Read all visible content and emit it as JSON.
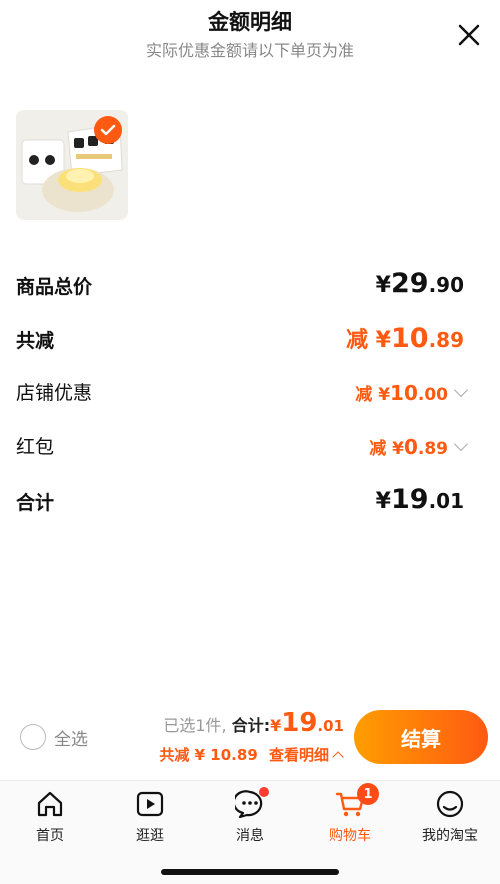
{
  "header": {
    "title": "金额明细",
    "subtitle": "实际优惠金额请以下单页为准"
  },
  "rows": [
    {
      "label": "商品总价",
      "prefix": "¥",
      "int": "29",
      "dec": ".90"
    },
    {
      "label": "共减",
      "prefix": "减 ¥",
      "int": "10",
      "dec": ".89"
    },
    {
      "label": "店铺优惠",
      "prefix": "减 ¥",
      "int": "10",
      "dec": ".00"
    },
    {
      "label": "红包",
      "prefix": "减 ¥",
      "int": "0",
      "dec": ".89"
    },
    {
      "label": "合计",
      "prefix": "¥",
      "int": "19",
      "dec": ".01"
    }
  ],
  "bottom": {
    "select_all": "全选",
    "selected_count": "已选1件,",
    "total_label": "合计:",
    "total_prefix": "¥",
    "total_int": "19",
    "total_dec": ".01",
    "discount_text": "共减 ¥ 10.89",
    "view_detail": "查看明细",
    "checkout": "结算"
  },
  "tabs": [
    {
      "label": "首页",
      "icon": "home-icon"
    },
    {
      "label": "逛逛",
      "icon": "play-icon"
    },
    {
      "label": "消息",
      "icon": "message-icon"
    },
    {
      "label": "购物车",
      "icon": "cart-icon",
      "badge": "1"
    },
    {
      "label": "我的淘宝",
      "icon": "profile-icon"
    }
  ],
  "colors": {
    "accent": "#ff5a12",
    "checkout_gradient_start": "#ff9d00",
    "checkout_gradient_end": "#ff5a12"
  }
}
